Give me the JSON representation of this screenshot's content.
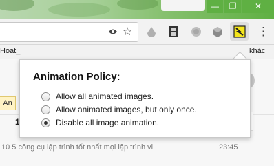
{
  "window": {
    "minimize_glyph": "—",
    "maximize_glyph": "❐",
    "close_glyph": "✕"
  },
  "toolbar": {
    "extensions": [
      "eye-extension-icon",
      "drop-extension-icon",
      "film-extension-icon",
      "globe-extension-icon",
      "cube-extension-icon",
      "lightning-extension-icon"
    ],
    "star_icon": "☆",
    "menu_icon": "⋮"
  },
  "bookmarks": {
    "left_item": "Hoat_",
    "right_item": "khác"
  },
  "page": {
    "side_button": "An",
    "row_number": "1",
    "article_text": "10 5 công cụ lập trình tốt nhất mọi lập trình vi",
    "article_time": "23:45"
  },
  "popup": {
    "title": "Animation Policy:",
    "options": [
      {
        "label": "Allow all animated images.",
        "selected": false
      },
      {
        "label": "Allow animated images, but only once.",
        "selected": false
      },
      {
        "label": "Disable all image animation.",
        "selected": true
      }
    ]
  },
  "colors": {
    "accent_green": "#5fb043",
    "highlight_yellow": "#fff3c4",
    "lightning_yellow": "#f5e61c"
  }
}
